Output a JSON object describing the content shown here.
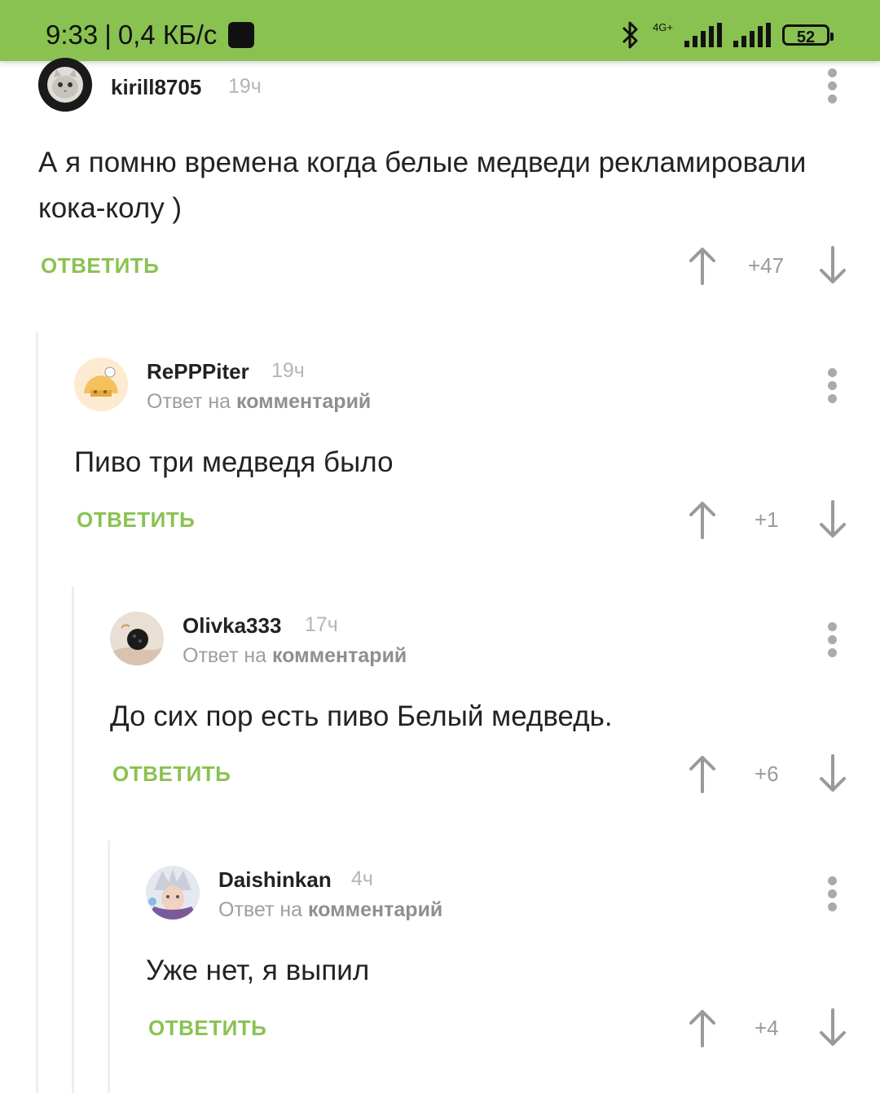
{
  "status_bar": {
    "time": "9:33",
    "speed": "0,4 КБ/с",
    "network": "4G+",
    "battery": "52"
  },
  "comments": [
    {
      "author": "kirill8705",
      "time": "19ч",
      "reply_prefix": "",
      "reply_link": "",
      "text": "А я помню времена когда белые медведи рекламировали кока-колу )",
      "reply_label": "ОТВЕТИТЬ",
      "rating": "+47"
    },
    {
      "author": "RePPPiter",
      "time": "19ч",
      "reply_prefix": "Ответ на",
      "reply_link": "комментарий",
      "text": "Пиво три медведя было",
      "reply_label": "ОТВЕТИТЬ",
      "rating": "+1"
    },
    {
      "author": "Olivka333",
      "time": "17ч",
      "reply_prefix": "Ответ на",
      "reply_link": "комментарий",
      "text": "До сих пор есть пиво Белый медведь.",
      "reply_label": "ОТВЕТИТЬ",
      "rating": "+6"
    },
    {
      "author": "Daishinkan",
      "time": "4ч",
      "reply_prefix": "Ответ на",
      "reply_link": "комментарий",
      "text": "Уже нет, я выпил",
      "reply_label": "ОТВЕТИТЬ",
      "rating": "+4"
    }
  ],
  "colors": {
    "accent": "#8ac251",
    "muted": "#9a9a9a"
  }
}
